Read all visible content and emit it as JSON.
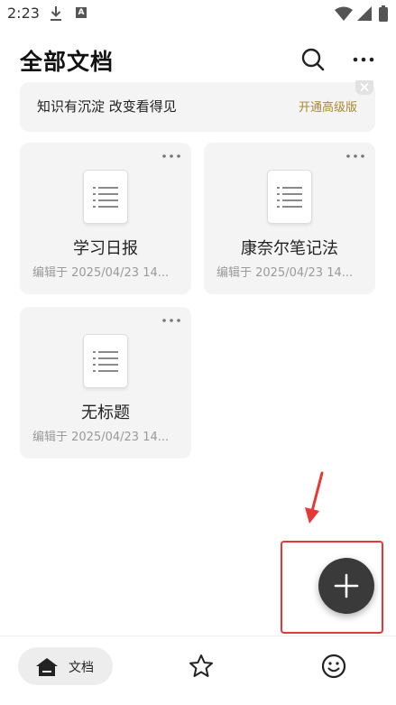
{
  "status_bar": {
    "time": "2:23",
    "icons": [
      "download-icon",
      "a-notification-icon",
      "wifi-icon",
      "signal-icon",
      "battery-icon"
    ]
  },
  "header": {
    "title": "全部文档",
    "icons": [
      "search-icon",
      "more-icon"
    ]
  },
  "promo": {
    "text": "知识有沉淀 改变看得见",
    "action": "开通高级版"
  },
  "documents": [
    {
      "title": "学习日报",
      "meta": "编辑于 2025/04/23 14..."
    },
    {
      "title": "康奈尔笔记法",
      "meta": "编辑于 2025/04/23 14..."
    },
    {
      "title": "无标题",
      "meta": "编辑于 2025/04/23 14..."
    }
  ],
  "bottom_nav": {
    "docs_label": "文档",
    "icons": [
      "home-icon",
      "star-icon",
      "smiley-icon"
    ]
  },
  "colors": {
    "accent_gold": "#a68a2c",
    "fab": "#3a3a3a",
    "annotation_red": "#e53935",
    "card_bg": "#f4f4f4"
  }
}
